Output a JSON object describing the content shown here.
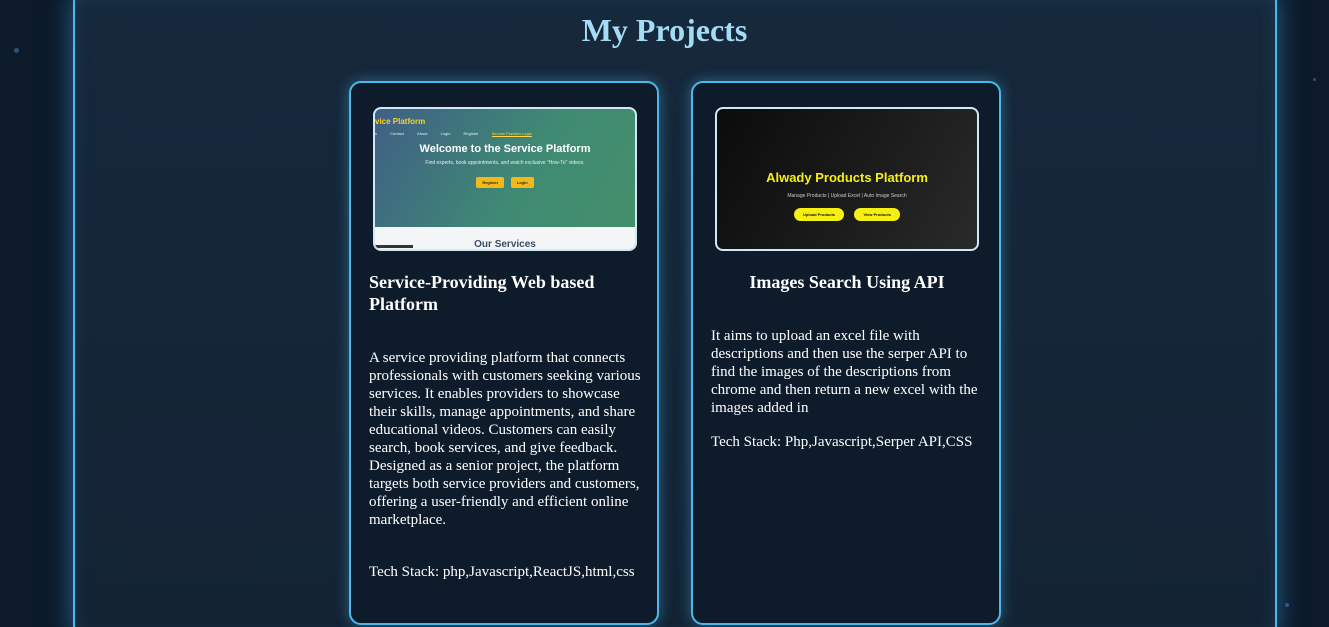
{
  "page": {
    "title": "My Projects"
  },
  "projects": [
    {
      "screenshot": {
        "brand": "vice Platform",
        "nav_links": [
          "s",
          "Contact",
          "About",
          "Login",
          "Register",
          "Service Provider Login"
        ],
        "heading": "Welcome to the Service Platform",
        "subtitle": "Find experts, book appointments, and watch exclusive \"How-To\" videos.",
        "buttons": [
          "Register",
          "Login"
        ],
        "section_heading": "Our Services"
      },
      "title": "Service-Providing Web based Platform",
      "description": "A service providing platform that connects professionals with customers seeking various services. It enables providers to showcase their skills, manage appointments, and share educational videos. Customers can easily search, book services, and give feedback. Designed as a senior project, the platform targets both service providers and customers, offering a user-friendly and efficient online marketplace.",
      "tech_stack": "Tech Stack: php,Javascript,ReactJS,html,css"
    },
    {
      "screenshot": {
        "heading": "Alwady Products Platform",
        "subtitle": "Manage Products | Upload Excel | Auto Image Search",
        "buttons": [
          "Upload Products",
          "View Products"
        ]
      },
      "title": "Images Search Using API",
      "description": "It aims to upload an excel file with descriptions and then use the serper API to find the images of the descriptions from chrome and then return a new excel with the images added in",
      "tech_stack": "Tech Stack: Php,Javascript,Serper API,CSS"
    }
  ],
  "colors": {
    "accent": "#4bb7ea",
    "title": "#a4dcf6",
    "background": "#0c1a2a",
    "card": "#0e1b2b"
  }
}
